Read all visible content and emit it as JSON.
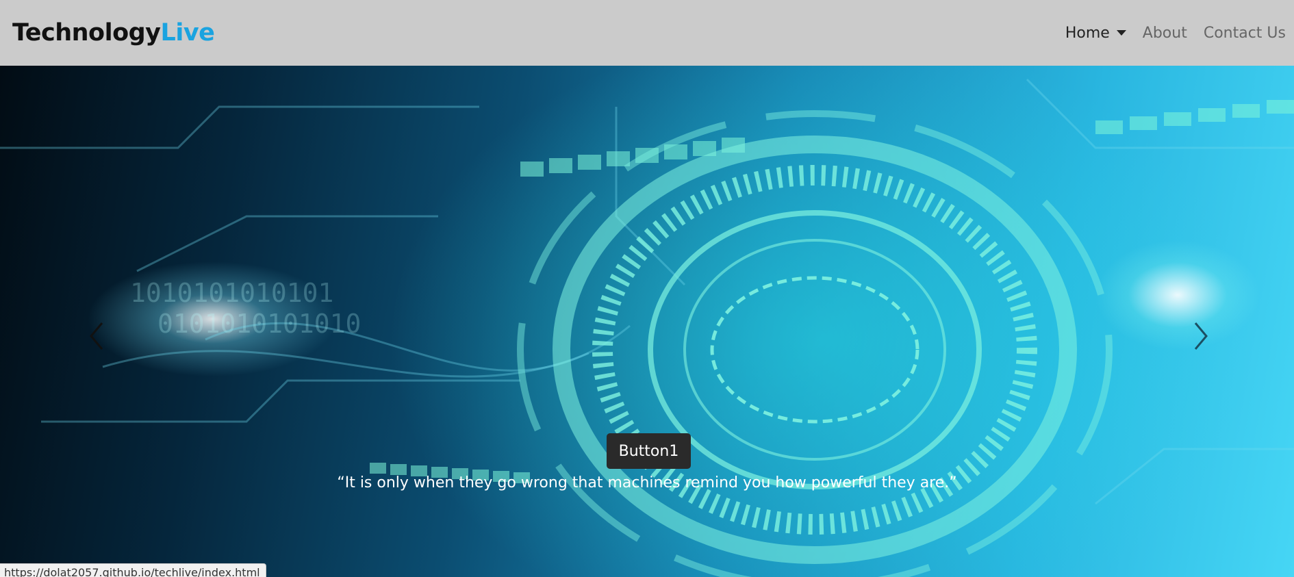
{
  "navbar": {
    "brand_main": "Technology",
    "brand_accent": "Live",
    "links": [
      {
        "label": "Home",
        "active": true,
        "dropdown": true
      },
      {
        "label": "About",
        "active": false
      },
      {
        "label": "Contact Us",
        "active": false
      }
    ]
  },
  "carousel": {
    "prev_icon": "chevron-left-icon",
    "next_icon": "chevron-right-icon",
    "button_label": "Button1",
    "quote": "“It is only when they go wrong that machines remind you how powerful they are.”"
  },
  "status_bar": {
    "url": "https://dolat2057.github.io/techlive/index.html"
  },
  "colors": {
    "navbar_bg": "#cbcbcb",
    "brand_accent": "#1aa3e0",
    "button_bg": "#2a2a2a"
  }
}
